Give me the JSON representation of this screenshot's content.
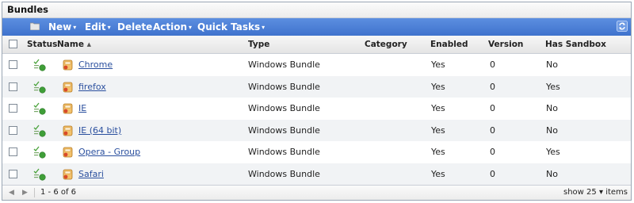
{
  "panel": {
    "title": "Bundles"
  },
  "toolbar": {
    "new_label": "New",
    "edit_label": "Edit",
    "delete_label": "Delete",
    "action_label": "Action",
    "quick_tasks_label": "Quick Tasks",
    "caret": "▾",
    "folder_icon": "folder-icon",
    "refresh_icon": "refresh-icon"
  },
  "table": {
    "headers": {
      "status": "Status",
      "name": "Name",
      "sort_indicator": "▲",
      "type": "Type",
      "category": "Category",
      "enabled": "Enabled",
      "version": "Version",
      "has_sandbox": "Has Sandbox"
    },
    "rows": [
      {
        "name": "Chrome",
        "type": "Windows Bundle",
        "category": "",
        "enabled": "Yes",
        "version": "0",
        "has_sandbox": "No"
      },
      {
        "name": "firefox",
        "type": "Windows Bundle",
        "category": "",
        "enabled": "Yes",
        "version": "0",
        "has_sandbox": "Yes"
      },
      {
        "name": "IE",
        "type": "Windows Bundle",
        "category": "",
        "enabled": "Yes",
        "version": "0",
        "has_sandbox": "No"
      },
      {
        "name": "IE (64 bit)",
        "type": "Windows Bundle",
        "category": "",
        "enabled": "Yes",
        "version": "0",
        "has_sandbox": "No"
      },
      {
        "name": "Opera - Group",
        "type": "Windows Bundle",
        "category": "",
        "enabled": "Yes",
        "version": "0",
        "has_sandbox": "Yes"
      },
      {
        "name": "Safari",
        "type": "Windows Bundle",
        "category": "",
        "enabled": "Yes",
        "version": "0",
        "has_sandbox": "No"
      }
    ]
  },
  "footer": {
    "prev_glyph": "◀",
    "next_glyph": "▶",
    "range_text": "1 - 6 of 6",
    "show_label": "show",
    "per_page": "25",
    "caret": "▾",
    "items_label": "items"
  },
  "colors": {
    "toolbar": "#4a7fd6",
    "link": "#2a4f9e",
    "row_alt": "#f1f3f5",
    "status_green": "#4aa33b",
    "bundle_orange": "#e8a23a"
  }
}
